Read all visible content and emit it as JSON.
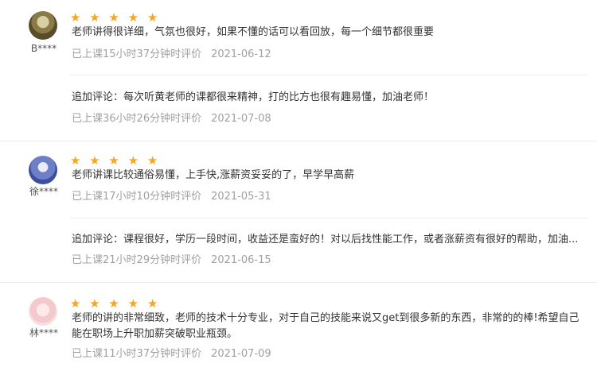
{
  "reviews": [
    {
      "username": "B****",
      "stars": "★ ★ ★ ★ ★",
      "comment": "老师讲得很详细，气氛也很好，如果不懂的话可以看回放，每一个细节都很重要",
      "time_label": "已上课15小时37分钟时评价",
      "date": "2021-06-12",
      "followup": "追加评论：每次听黄老师的课都很来精神，打的比方也很有趣易懂，加油老师！",
      "followup_time": "已上课36小时26分钟时评价",
      "followup_date": "2021-07-08"
    },
    {
      "username": "徐****",
      "stars": "★ ★ ★ ★ ★",
      "comment": "老师讲课比较通俗易懂，上手快,涨薪资妥妥的了，早学早高薪",
      "time_label": "已上课17小时10分钟时评价",
      "date": "2021-05-31",
      "followup": "追加评论：课程很好，学历一段时间，收益还是蛮好的！对以后找性能工作，或者涨薪资有很好的帮助，加油...",
      "followup_time": "已上课21小时29分钟时评价",
      "followup_date": "2021-06-15"
    },
    {
      "username": "林****",
      "stars": "★ ★ ★ ★ ★",
      "comment": "老师的讲的非常细致，老师的技术十分专业，对于自己的技能来说又get到很多新的东西，非常的的棒!希望自己能在职场上升职加薪突破职业瓶颈。",
      "time_label": "已上课11小时37分钟时评价",
      "date": "2021-07-09"
    }
  ]
}
